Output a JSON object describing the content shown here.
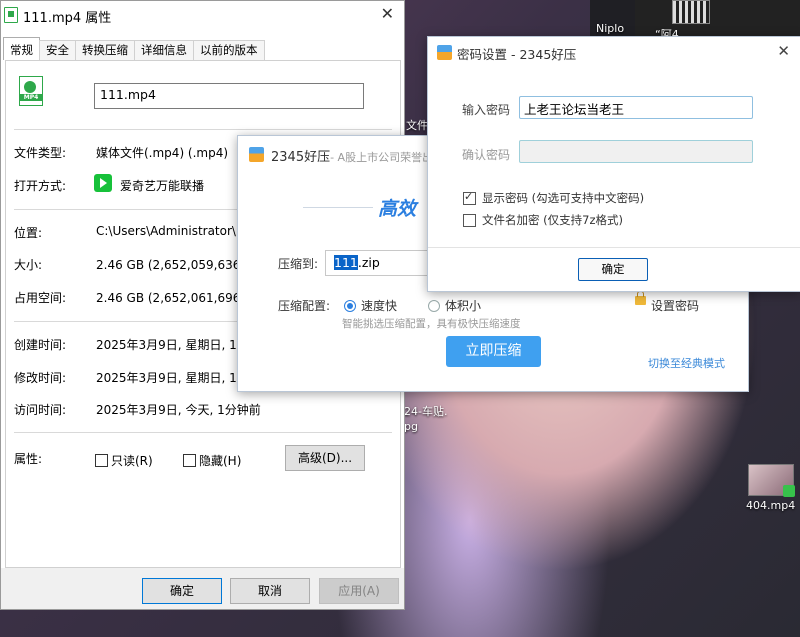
{
  "desktop": {
    "labels": {
      "top_left": "Niplo",
      "top_mid": "“阿4",
      "left_file": "文件",
      "left_file2": "文",
      "doc": "24-车贴.",
      "doc2": "pg",
      "file_404": "404.mp4"
    }
  },
  "properties": {
    "title": "111.mp4 属性",
    "tabs": [
      "常规",
      "安全",
      "转换压缩",
      "详细信息",
      "以前的版本"
    ],
    "file_name": "111.mp4",
    "icon_label": "MP4",
    "rows": {
      "type_label": "文件类型:",
      "type_value": "媒体文件(.mp4) (.mp4)",
      "open_label": "打开方式:",
      "open_value": "爱奇艺万能联播",
      "location_label": "位置:",
      "location_value": "C:\\Users\\Administrator\\De",
      "size_label": "大小:",
      "size_value": "2.46 GB (2,652,059,636 字节)",
      "disk_label": "占用空间:",
      "disk_value": "2.46 GB (2,652,061,696 字节)",
      "created_label": "创建时间:",
      "created_value": "2025年3月9日, 星期日, 12:",
      "modified_label": "修改时间:",
      "modified_value": "2025年3月9日, 星期日, 12:",
      "accessed_label": "访问时间:",
      "accessed_value": "2025年3月9日, 今天, 1分钟前",
      "attr_label": "属性:"
    },
    "readonly_label": "只读(R)",
    "hidden_label": "隐藏(H)",
    "advanced_button": "高级(D)...",
    "ok_button": "确定",
    "cancel_button": "取消",
    "apply_button": "应用(A)"
  },
  "compressor": {
    "title": "2345好压",
    "subtitle": "- A股上市公司荣誉出",
    "slogan": "高效",
    "compress_to_label": "压缩到:",
    "path_selected": "111",
    "path_rest": ".zip",
    "config_label": "压缩配置:",
    "option_fast": "速度快",
    "option_small": "体积小",
    "set_password": "设置密码",
    "hint": "智能挑选压缩配置，具有极快压缩速度",
    "compress_button": "立即压缩",
    "switch_mode": "切换至经典模式"
  },
  "password_dialog": {
    "title": "密码设置 - 2345好压",
    "enter_label": "输入密码",
    "enter_value": "上老王论坛当老王",
    "confirm_label": "确认密码",
    "confirm_value": "",
    "show_password": "显示密码 (勾选可支持中文密码)",
    "show_password_checked": true,
    "encrypt_names": "文件名加密 (仅支持7z格式)",
    "encrypt_names_checked": false,
    "ok_button": "确定"
  }
}
